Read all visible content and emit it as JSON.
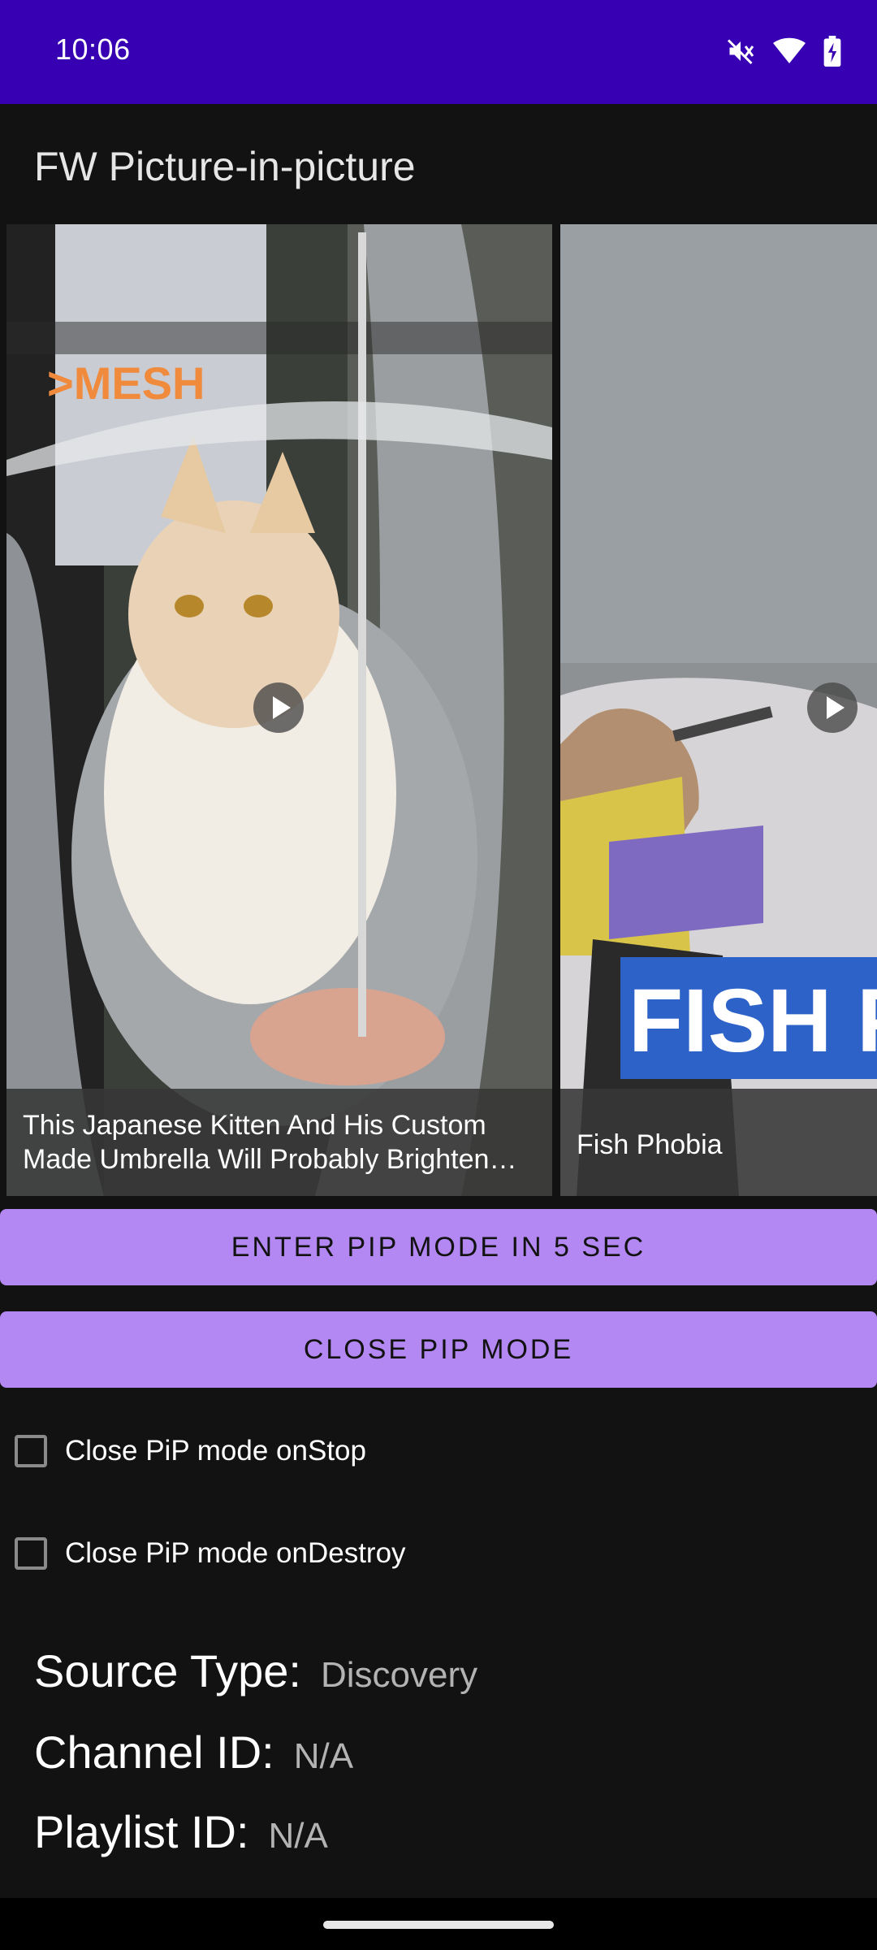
{
  "status_bar": {
    "time": "10:06",
    "icons": [
      "mute-icon",
      "wifi-icon",
      "battery-charging-icon"
    ]
  },
  "app": {
    "title": "FW Picture-in-picture"
  },
  "carousel": {
    "videos": [
      {
        "caption": "This Japanese Kitten And His Custom Made Umbrella Will Probably Brighten…",
        "thumbnail_text": ">MESH"
      },
      {
        "caption": "Fish Phobia",
        "thumbnail_text": "FISH PH"
      }
    ]
  },
  "buttons": {
    "enter_pip": "ENTER PIP MODE IN 5 SEC",
    "close_pip": "CLOSE PIP MODE"
  },
  "options": [
    {
      "label": "Close PiP mode onStop",
      "checked": false
    },
    {
      "label": "Close PiP mode onDestroy",
      "checked": false
    }
  ],
  "info": {
    "source_type_label": "Source Type:",
    "source_type_value": "Discovery",
    "channel_id_label": "Channel ID:",
    "channel_id_value": "N/A",
    "playlist_id_label": "Playlist ID:",
    "playlist_id_value": "N/A"
  },
  "colors": {
    "status_bar": "#3700b3",
    "background": "#121212",
    "button": "#b388f3"
  }
}
